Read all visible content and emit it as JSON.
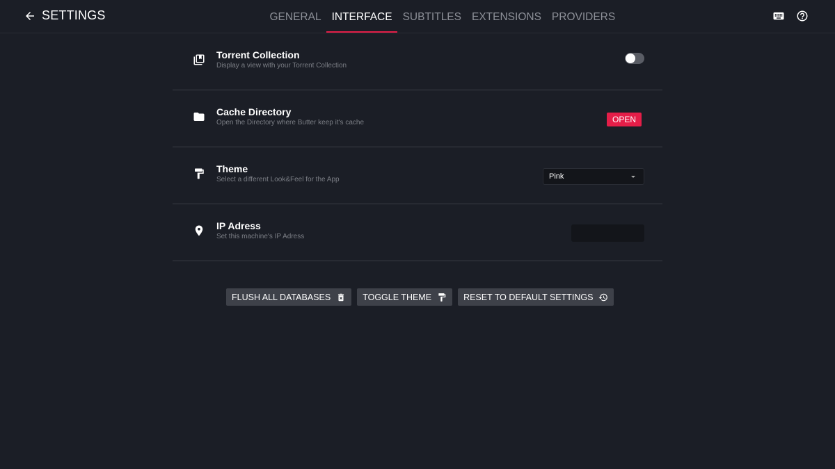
{
  "header": {
    "title": "SETTINGS",
    "back_icon": "arrow-left-icon",
    "right_icons": [
      "keyboard-icon",
      "help-circle-icon"
    ]
  },
  "tabs": [
    {
      "label": "GENERAL",
      "active": false
    },
    {
      "label": "INTERFACE",
      "active": true
    },
    {
      "label": "SUBTITLES",
      "active": false
    },
    {
      "label": "EXTENSIONS",
      "active": false
    },
    {
      "label": "PROVIDERS",
      "active": false
    }
  ],
  "settings": {
    "torrent_collection": {
      "title": "Torrent Collection",
      "description": "Display a view with your Torrent Collection",
      "icon": "collection-icon",
      "enabled": false
    },
    "cache_directory": {
      "title": "Cache Directory",
      "description": "Open the Directory where Butter keep it's cache",
      "icon": "folder-icon",
      "button_label": "OPEN"
    },
    "theme": {
      "title": "Theme",
      "description": "Select a different Look&Feel for the App",
      "icon": "paint-roller-icon",
      "selected": "Pink"
    },
    "ip_address": {
      "title": "IP Adress",
      "description": "Set this machine's IP Adress",
      "icon": "location-pin-icon",
      "value": ""
    }
  },
  "actions": {
    "flush": {
      "label": "FLUSH ALL DATABASES",
      "icon": "trash-icon"
    },
    "toggle_theme": {
      "label": "TOGGLE THEME",
      "icon": "paint-roller-icon"
    },
    "reset": {
      "label": "RESET TO DEFAULT SETTINGS",
      "icon": "history-icon"
    }
  },
  "colors": {
    "background": "#1b1e26",
    "accent": "#e41e48",
    "button": "#3e4149",
    "muted_text": "#7c7f86"
  }
}
